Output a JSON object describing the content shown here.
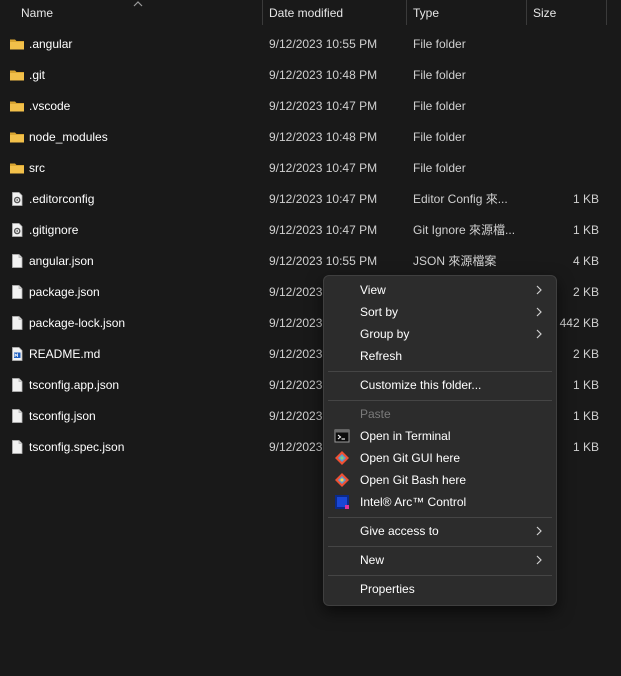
{
  "header": {
    "name": "Name",
    "date_modified": "Date modified",
    "type": "Type",
    "size": "Size"
  },
  "files": [
    {
      "name": ".angular",
      "date": "9/12/2023 10:55 PM",
      "type": "File folder",
      "size": "",
      "icon": "folder-icon"
    },
    {
      "name": ".git",
      "date": "9/12/2023 10:48 PM",
      "type": "File folder",
      "size": "",
      "icon": "folder-icon"
    },
    {
      "name": ".vscode",
      "date": "9/12/2023 10:47 PM",
      "type": "File folder",
      "size": "",
      "icon": "folder-icon"
    },
    {
      "name": "node_modules",
      "date": "9/12/2023 10:48 PM",
      "type": "File folder",
      "size": "",
      "icon": "folder-icon"
    },
    {
      "name": "src",
      "date": "9/12/2023 10:47 PM",
      "type": "File folder",
      "size": "",
      "icon": "folder-icon"
    },
    {
      "name": ".editorconfig",
      "date": "9/12/2023 10:47 PM",
      "type": "Editor Config 來...",
      "size": "1 KB",
      "icon": "config-file-icon"
    },
    {
      "name": ".gitignore",
      "date": "9/12/2023 10:47 PM",
      "type": "Git Ignore 來源檔...",
      "size": "1 KB",
      "icon": "config-file-icon"
    },
    {
      "name": "angular.json",
      "date": "9/12/2023 10:55 PM",
      "type": "JSON 來源檔案",
      "size": "4 KB",
      "icon": "file-icon"
    },
    {
      "name": "package.json",
      "date": "9/12/2023",
      "type": "",
      "size": "2 KB",
      "icon": "file-icon"
    },
    {
      "name": "package-lock.json",
      "date": "9/12/2023",
      "type": "",
      "size": "442 KB",
      "icon": "file-icon"
    },
    {
      "name": "README.md",
      "date": "9/12/2023",
      "type": "",
      "size": "2 KB",
      "icon": "markdown-file-icon"
    },
    {
      "name": "tsconfig.app.json",
      "date": "9/12/2023",
      "type": "",
      "size": "1 KB",
      "icon": "file-icon"
    },
    {
      "name": "tsconfig.json",
      "date": "9/12/2023",
      "type": "",
      "size": "1 KB",
      "icon": "file-icon"
    },
    {
      "name": "tsconfig.spec.json",
      "date": "9/12/2023",
      "type": "",
      "size": "1 KB",
      "icon": "file-icon"
    }
  ],
  "context_menu": {
    "view": "View",
    "sort_by": "Sort by",
    "group_by": "Group by",
    "refresh": "Refresh",
    "customize": "Customize this folder...",
    "paste": "Paste",
    "open_terminal": "Open in Terminal",
    "git_gui": "Open Git GUI here",
    "git_bash": "Open Git Bash here",
    "intel_arc": "Intel® Arc™ Control",
    "give_access": "Give access to",
    "new": "New",
    "properties": "Properties"
  },
  "colors": {
    "background": "#191919",
    "folder": "#f2c04a",
    "menu_background": "#2c2c2c",
    "text": "#ffffff",
    "disabled_text": "#7a7a7a"
  }
}
